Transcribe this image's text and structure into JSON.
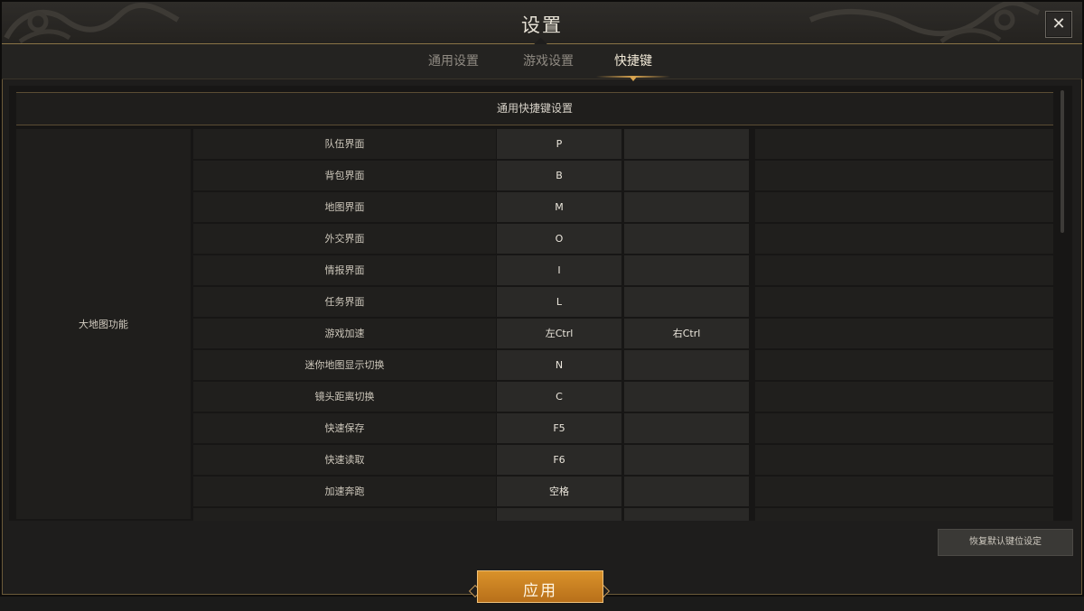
{
  "window": {
    "title": "设置",
    "close_glyph": "✕"
  },
  "tabs": [
    {
      "label": "通用设置",
      "active": false
    },
    {
      "label": "游戏设置",
      "active": false
    },
    {
      "label": "快捷键",
      "active": true
    }
  ],
  "section": {
    "title": "通用快捷键设置",
    "group": "大地图功能",
    "rows": [
      {
        "action": "队伍界面",
        "key1": "P",
        "key2": ""
      },
      {
        "action": "背包界面",
        "key1": "B",
        "key2": ""
      },
      {
        "action": "地图界面",
        "key1": "M",
        "key2": ""
      },
      {
        "action": "外交界面",
        "key1": "O",
        "key2": ""
      },
      {
        "action": "情报界面",
        "key1": "I",
        "key2": ""
      },
      {
        "action": "任务界面",
        "key1": "L",
        "key2": ""
      },
      {
        "action": "游戏加速",
        "key1": "左Ctrl",
        "key2": "右Ctrl"
      },
      {
        "action": "迷你地图显示切换",
        "key1": "N",
        "key2": ""
      },
      {
        "action": "镜头距离切换",
        "key1": "C",
        "key2": ""
      },
      {
        "action": "快速保存",
        "key1": "F5",
        "key2": ""
      },
      {
        "action": "快速读取",
        "key1": "F6",
        "key2": ""
      },
      {
        "action": "加速奔跑",
        "key1": "空格",
        "key2": ""
      },
      {
        "action": "",
        "key1": "",
        "key2": ""
      }
    ]
  },
  "footer": {
    "restore_label": "恢复默认键位设定",
    "apply_label": "应用"
  },
  "colors": {
    "accent_gold": "#d9a550",
    "apply_orange": "#c98222"
  }
}
